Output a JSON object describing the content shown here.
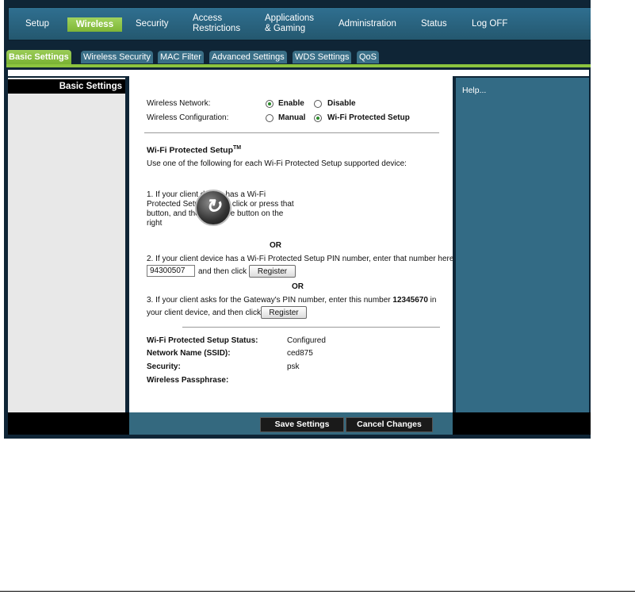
{
  "nav": {
    "setup": "Setup",
    "wireless": "Wireless",
    "security": "Security",
    "access": [
      "Access",
      "Restrictions"
    ],
    "apps": [
      "Applications",
      "& Gaming"
    ],
    "administration": "Administration",
    "status": "Status",
    "logoff": "Log OFF"
  },
  "tabs": [
    "Basic Settings",
    "Wireless Security",
    "MAC Filter",
    "Advanced Settings",
    "WDS Settings",
    "QoS"
  ],
  "left_header": "Basic Settings",
  "help": "Help...",
  "form": {
    "wireless_network_label": "Wireless Network:",
    "enable": "Enable",
    "disable": "Disable",
    "wireless_config_label": "Wireless Configuration:",
    "manual": "Manual",
    "wps": "Wi-Fi Protected Setup"
  },
  "wps": {
    "heading": "Wi-Fi Protected Setup",
    "tm": "TM",
    "intro": "Use one of the following for each Wi-Fi Protected Setup supported device:",
    "step1_lines": [
      "1. If your client device has a Wi-Fi",
      "Protected Setup button, click or press that",
      "button, and then click the button on the",
      "right"
    ],
    "or1": "OR",
    "step2": "2. If your client device has a Wi-Fi Protected Setup PIN number, enter that number here",
    "pin_value": "94300507",
    "and_then_click": "and then click",
    "register": "Register",
    "or2": "OR",
    "step3_a": "3. If your client asks for the Gateway's PIN number, enter this number ",
    "gateway_pin": "12345670",
    "step3_b": " in",
    "step3_c": "your client device, and then click",
    "register2": "Register"
  },
  "status": {
    "wps_status_label": "Wi-Fi Protected Setup Status:",
    "wps_status_value": "Configured",
    "ssid_label": "Network Name (SSID):",
    "ssid_value": "ced875",
    "security_label": "Security:",
    "security_value": "psk",
    "passphrase_label": "Wireless Passphrase:"
  },
  "buttons": {
    "save": "Save Settings",
    "cancel": "Cancel Changes"
  },
  "colors": {
    "nav_bg": "#2f6f90",
    "accent_green": "#8cc43f",
    "help_bg": "#336b85"
  }
}
